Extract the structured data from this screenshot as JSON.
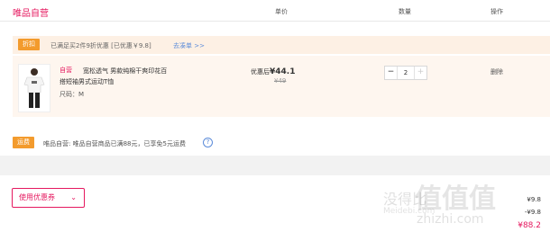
{
  "header": {
    "store_title": "唯品自营",
    "col_price": "单价",
    "col_qty": "数量",
    "col_ops": "操作"
  },
  "promo": {
    "tag": "折扣",
    "text": "已满足买2件9折优惠 [已优惠￥9.8]",
    "link": "去凑单 >>"
  },
  "item": {
    "self_operated": "自营",
    "title": "宽松透气 男款纯棉干爽印花百搭短袖男式运动T恤",
    "size_label": "尺码：",
    "size_value": "M",
    "price_label": "优惠后",
    "price_now": "¥44.1",
    "price_old": "¥49",
    "quantity": "2",
    "minus_label": "−",
    "plus_label": "+",
    "delete_label": "删除"
  },
  "shipping": {
    "tag": "运费",
    "text": "唯品自营: 唯品自营商品已满88元，已享免5元运费",
    "help": "?"
  },
  "bottom": {
    "coupon_button": "使用优惠券",
    "coupon_chevron": "⌄",
    "summary_1": "¥9.8",
    "summary_2": "-¥9.8",
    "summary_3": "¥88.2"
  },
  "watermark": {
    "site": "没得比",
    "url": "Meidebi.com",
    "big": "值值值",
    "domain": "zhizhi.com"
  },
  "colors": {
    "accent": "#e5185f",
    "tag_orange": "#f39b2d",
    "promo_bg": "#fdf0e4",
    "link_blue": "#5b8bd9"
  }
}
